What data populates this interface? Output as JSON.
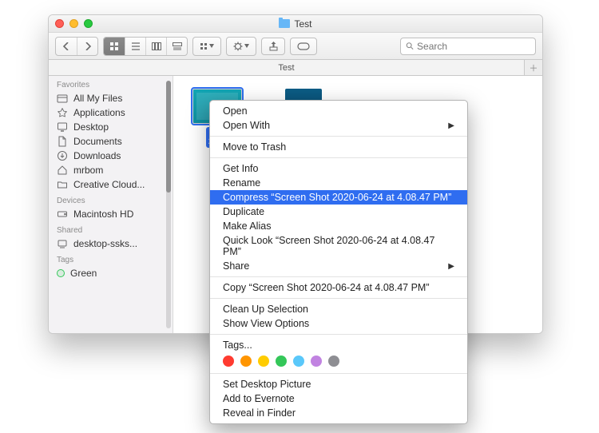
{
  "window": {
    "title": "Test"
  },
  "toolbar": {},
  "tab": {
    "label": "Test"
  },
  "search": {
    "placeholder": "Search"
  },
  "sidebar": {
    "sections": [
      {
        "title": "Favorites",
        "items": [
          {
            "label": "All My Files"
          },
          {
            "label": "Applications"
          },
          {
            "label": "Desktop"
          },
          {
            "label": "Documents"
          },
          {
            "label": "Downloads"
          },
          {
            "label": "mrbom"
          },
          {
            "label": "Creative Cloud..."
          }
        ]
      },
      {
        "title": "Devices",
        "items": [
          {
            "label": "Macintosh HD"
          }
        ]
      },
      {
        "title": "Shared",
        "items": [
          {
            "label": "desktop-ssks..."
          }
        ]
      },
      {
        "title": "Tags",
        "items": [
          {
            "label": "Green",
            "color": "#34c759"
          }
        ]
      }
    ]
  },
  "files": {
    "selected": {
      "line1": "Sc",
      "line2": "2020"
    }
  },
  "context_menu": {
    "items": [
      {
        "label": "Open"
      },
      {
        "label": "Open With",
        "submenu": true
      },
      {
        "sep": true
      },
      {
        "label": "Move to Trash"
      },
      {
        "sep": true
      },
      {
        "label": "Get Info"
      },
      {
        "label": "Rename"
      },
      {
        "label": "Compress “Screen Shot 2020-06-24 at 4.08.47 PM”",
        "highlight": true
      },
      {
        "label": "Duplicate"
      },
      {
        "label": "Make Alias"
      },
      {
        "label": "Quick Look “Screen Shot 2020-06-24 at 4.08.47 PM”"
      },
      {
        "label": "Share",
        "submenu": true
      },
      {
        "sep": true
      },
      {
        "label": "Copy “Screen Shot 2020-06-24 at 4.08.47 PM”"
      },
      {
        "sep": true
      },
      {
        "label": "Clean Up Selection"
      },
      {
        "label": "Show View Options"
      },
      {
        "sep": true
      },
      {
        "label": "Tags..."
      },
      {
        "tags": true,
        "colors": [
          "#ff3b30",
          "#ff9500",
          "#ffcc00",
          "#34c759",
          "#5ac8fa",
          "#c183e1",
          "#8e8e93"
        ]
      },
      {
        "sep": true
      },
      {
        "label": "Set Desktop Picture"
      },
      {
        "label": "Add to Evernote"
      },
      {
        "label": "Reveal in Finder"
      }
    ]
  }
}
